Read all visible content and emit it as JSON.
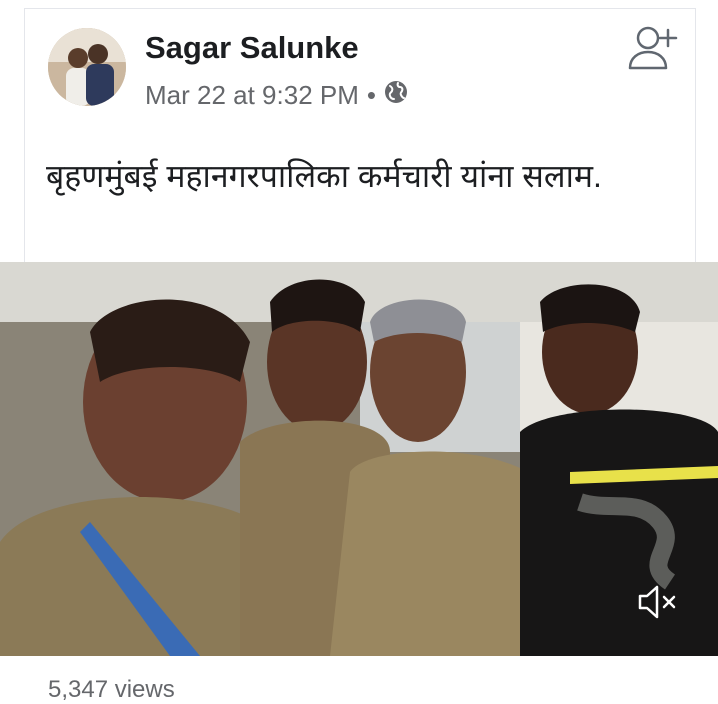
{
  "post": {
    "author": "Sagar Salunke",
    "date": "Mar 22 at 9:32 PM",
    "separator": "•",
    "audience_icon": "globe-icon",
    "text": "बृहणमुंबई महानगरपालिका कर्मचारी यांना सलाम.",
    "views": "5,347 views"
  },
  "icons": {
    "add_friend": "add-friend-icon",
    "mute": "speaker-muted-icon"
  },
  "colors": {
    "text_primary": "#1c1e21",
    "text_secondary": "#65676b",
    "icon_gray": "#606770"
  }
}
